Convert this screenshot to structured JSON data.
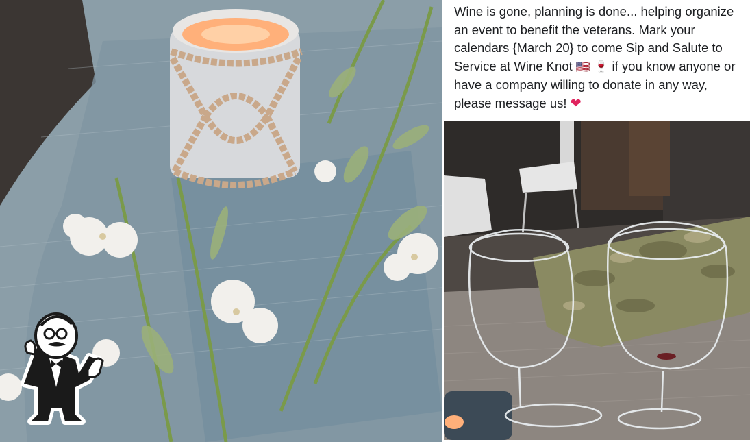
{
  "post": {
    "line1": "Wine is gone, planning is done... helping organize",
    "line2": "an event to benefit the veterans. Mark your",
    "line3": "calendars {March 20} to come Sip and Salute to",
    "line4a": "Service at Wine Knot",
    "flag_emoji": "🇺🇸",
    "wine_emoji": "🍷",
    "line4b": "if you know anyone or",
    "line5": "have a company willing to donate in any way,",
    "line6": "please message us!",
    "heart_emoji": "❤"
  },
  "photos": {
    "left": "candle-and-flower-table-runner",
    "right": "two-wine-glasses-on-camo-runner"
  },
  "mascot": "waiter-thumbs-up-icon",
  "colors": {
    "text": "#1c1e21",
    "gauze": "#8fa3ad",
    "candle_glow": "#ffb07a",
    "camo": "#8a8a62"
  }
}
